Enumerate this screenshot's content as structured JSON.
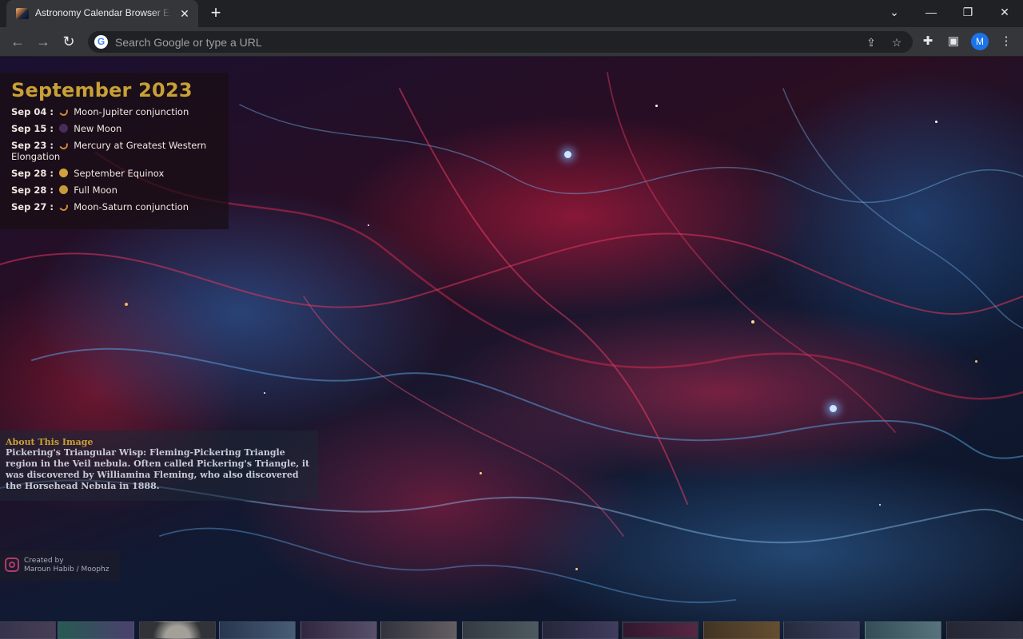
{
  "browser": {
    "tab": {
      "title": "Astronomy Calendar Browser Extension"
    },
    "omnibox": {
      "placeholder": "Search Google or type a URL"
    },
    "profile": {
      "initial": "M"
    }
  },
  "calendar": {
    "title": "September 2023",
    "events": [
      {
        "date": "Sep 04 :",
        "icon": "conjunction-icon",
        "label": "Moon-Jupiter conjunction"
      },
      {
        "date": "Sep 15 :",
        "icon": "new-moon-icon",
        "label": "New Moon"
      },
      {
        "date": "Sep 23 :",
        "icon": "conjunction-icon",
        "label": "Mercury at Greatest Western Elongation"
      },
      {
        "date": "Sep 28 :",
        "icon": "equinox-icon",
        "label": "September Equinox"
      },
      {
        "date": "Sep 28 :",
        "icon": "full-moon-icon",
        "label": "Full Moon"
      },
      {
        "date": "Sep 27 :",
        "icon": "conjunction-icon",
        "label": "Moon-Saturn conjunction"
      }
    ]
  },
  "about": {
    "heading": "About This Image",
    "text": "Pickering's Triangular Wisp: Fleming-Pickering Triangle region in the Veil nebula. Often called Pickering's Triangle, it was discovered by Williamina Fleming, who also discovered the Horsehead Nebula in 1888."
  },
  "credit": {
    "line1": "Created by",
    "line2": "Maroun Habib / Moophz"
  },
  "colors": {
    "accent_gold": "#c8a036",
    "chrome_dark": "#202124",
    "toolbar": "#35363a",
    "profile_blue": "#1a73e8"
  }
}
